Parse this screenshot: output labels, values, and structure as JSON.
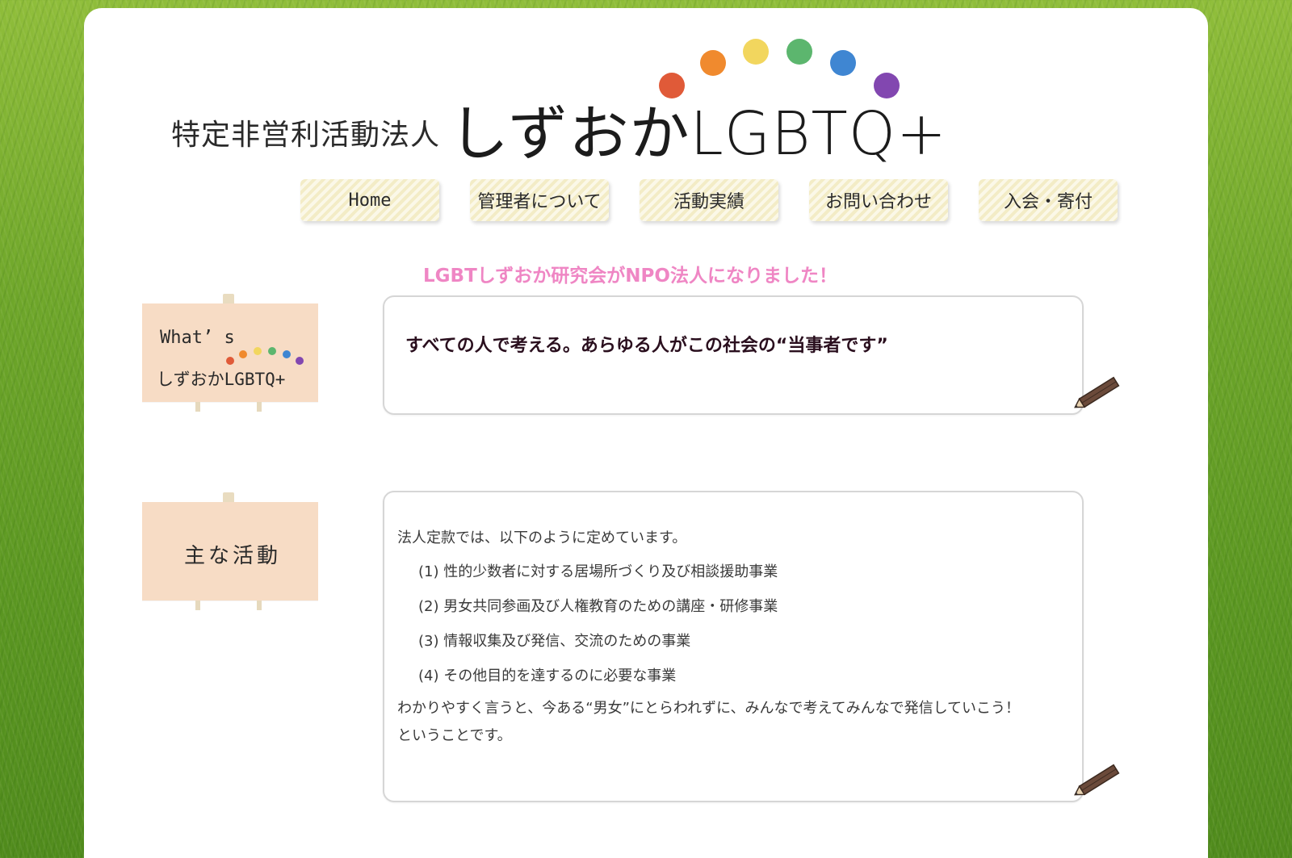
{
  "header": {
    "org_prefix": "特定非営利活動法人",
    "org_name": "しずおかLGBTQ+",
    "dot_colors": [
      "#e05a38",
      "#f08a2e",
      "#f2d65e",
      "#5cb66e",
      "#3f86d2",
      "#8247b0"
    ]
  },
  "nav": {
    "items": [
      {
        "label": "Home"
      },
      {
        "label": "管理者について"
      },
      {
        "label": "活動実績"
      },
      {
        "label": "お問い合わせ"
      },
      {
        "label": "入会・寄付"
      }
    ]
  },
  "announcement": "LGBTしずおか研究会がNPO法人になりました！",
  "whats": {
    "sign_line1": "What’ s",
    "sign_line2": "しずおかLGBTQ+",
    "tagline": "すべての人で考える。あらゆる人がこの社会の“当事者です”"
  },
  "activities": {
    "sign_title": "主な活動",
    "intro": "法人定款では、以下のように定めています。",
    "items": [
      "(1)  性的少数者に対する居場所づくり及び相談援助事業",
      "(2)  男女共同参画及び人権教育のための講座・研修事業",
      "(3)  情報収集及び発信、交流のための事業",
      "(4)  その他目的を達するのに必要な事業"
    ],
    "summary_line1": "わかりやすく言うと、今ある“男女”にとらわれずに、みんなで考えてみんなで発信していこう！",
    "summary_line2": "ということです。"
  }
}
